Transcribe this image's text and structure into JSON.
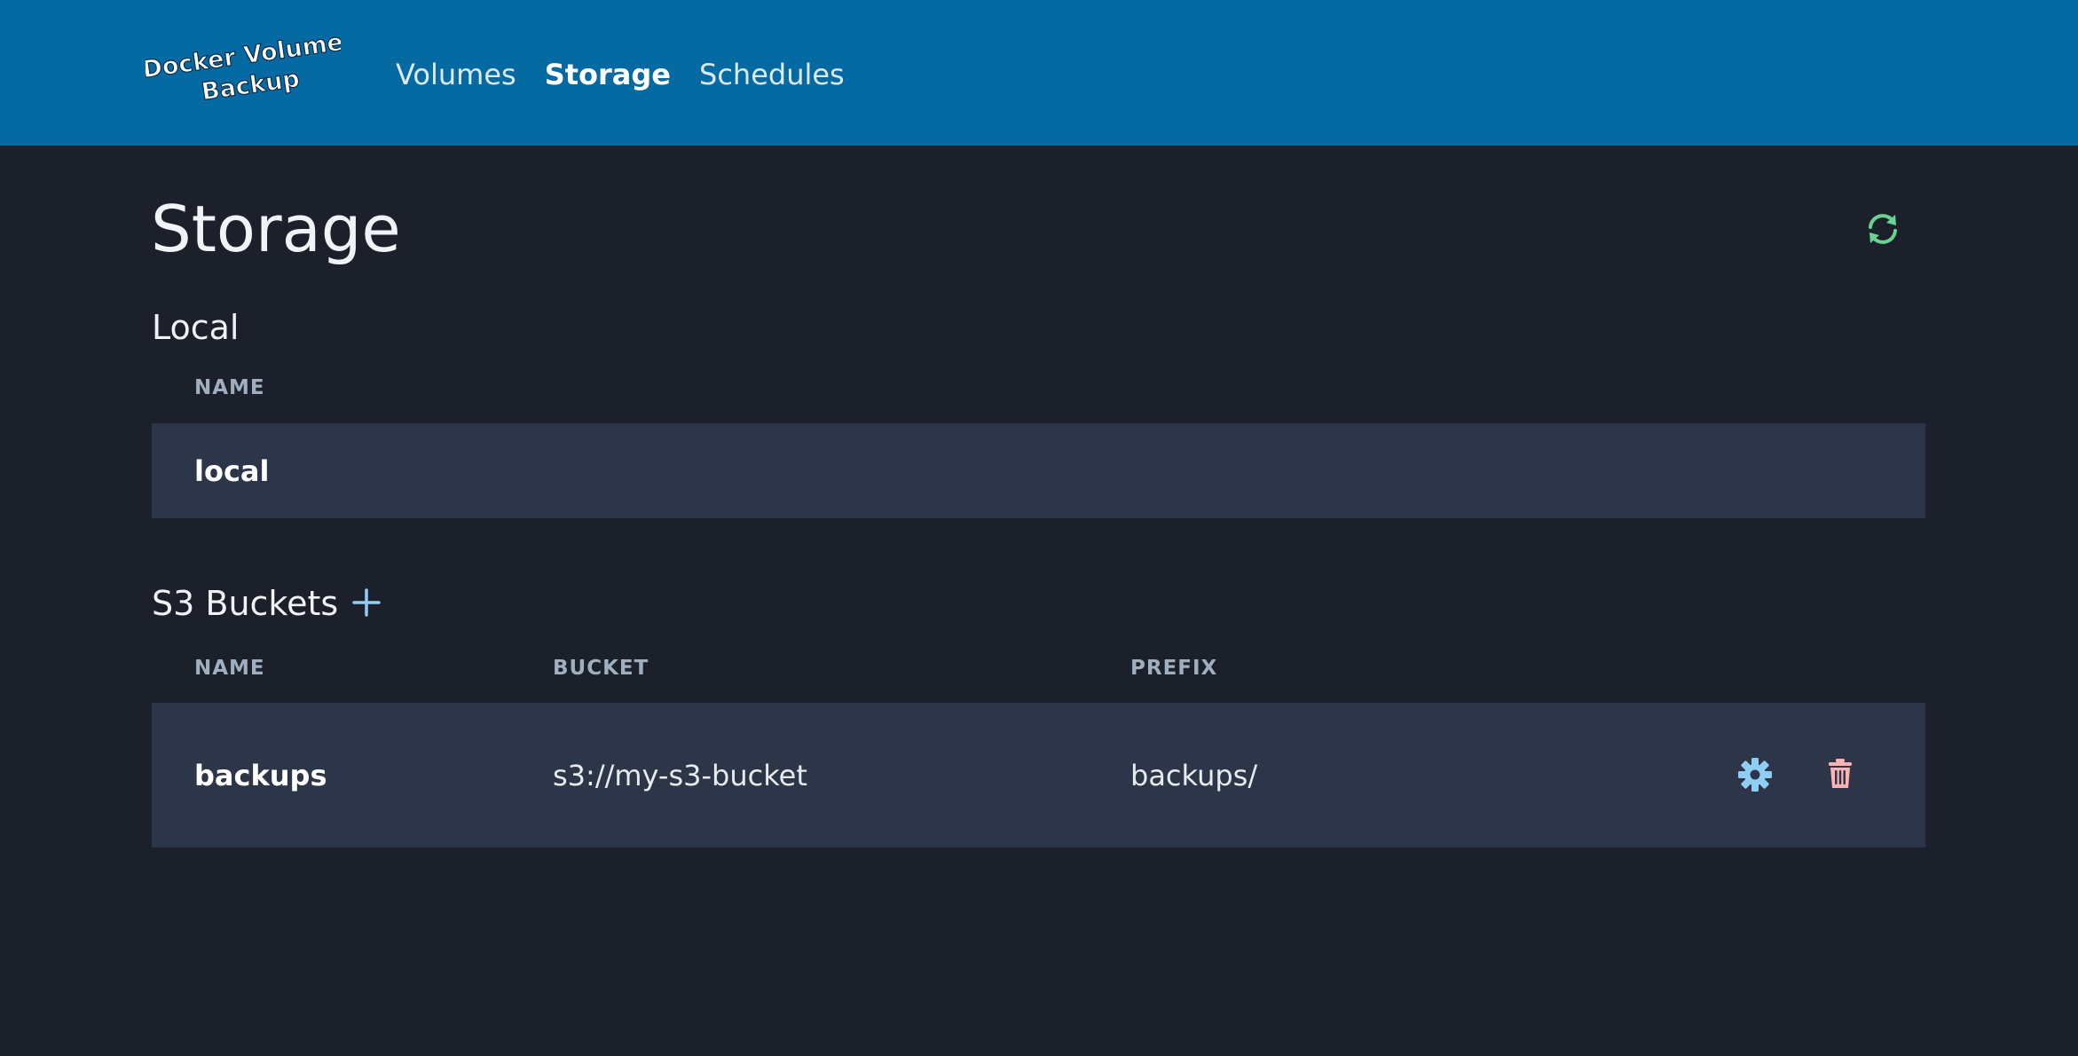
{
  "app": {
    "logo_text_line1": "Docker Volume",
    "logo_text_line2": "Backup"
  },
  "nav": {
    "items": [
      {
        "label": "Volumes",
        "active": false
      },
      {
        "label": "Storage",
        "active": true
      },
      {
        "label": "Schedules",
        "active": false
      }
    ]
  },
  "page": {
    "title": "Storage",
    "refresh_icon": "refresh-icon"
  },
  "local": {
    "title": "Local",
    "columns": [
      "NAME"
    ],
    "rows": [
      {
        "name": "local"
      }
    ]
  },
  "s3": {
    "title": "S3 Buckets",
    "add_icon": "plus-icon",
    "columns": [
      "NAME",
      "BUCKET",
      "PREFIX"
    ],
    "rows": [
      {
        "name": "backups",
        "bucket": "s3://my-s3-bucket",
        "prefix": "backups/",
        "settings_icon": "gear-icon",
        "delete_icon": "trash-icon"
      }
    ]
  },
  "colors": {
    "header_bg": "#056aa1",
    "page_bg": "#1b202b",
    "row_bg": "#2d3648",
    "refresh_green": "#68d391",
    "add_blue": "#90cdf4",
    "gear_blue": "#90cdf4",
    "trash_red": "#feb2b2"
  }
}
